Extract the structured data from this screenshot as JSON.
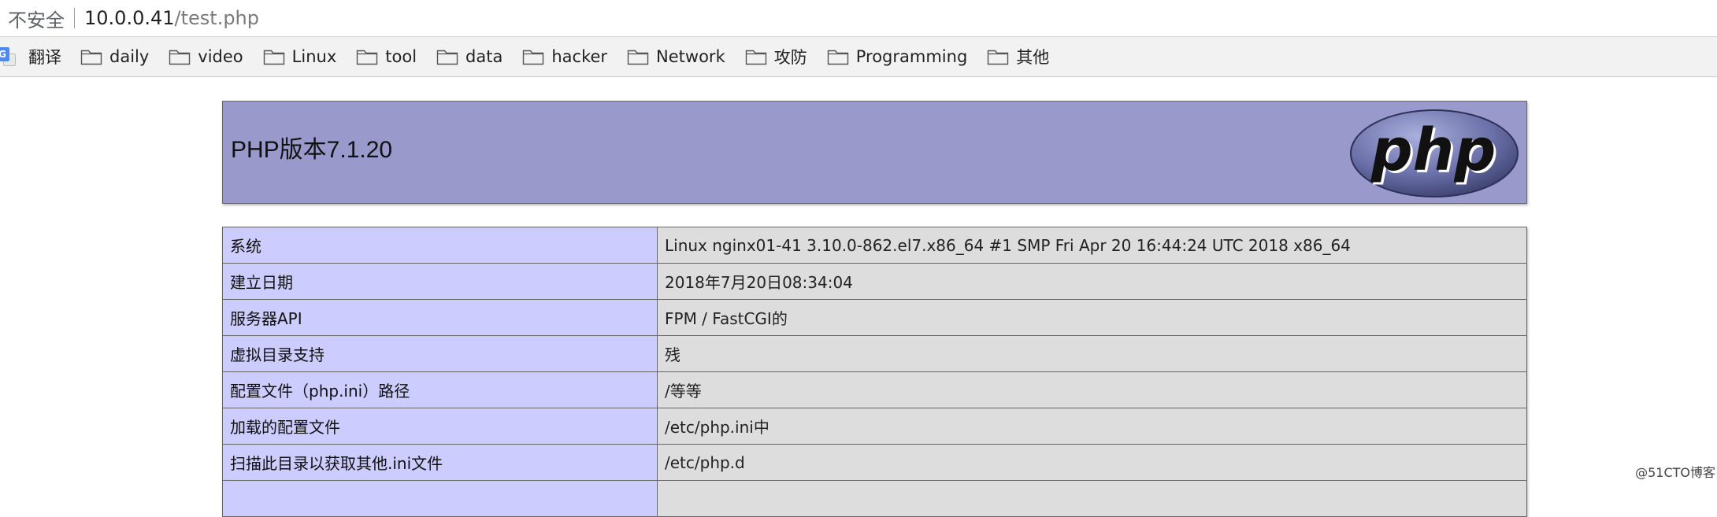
{
  "address_bar": {
    "security_label": "不安全",
    "host": "10.0.0.41",
    "path": "/test.php"
  },
  "bookmarks": [
    {
      "label": "翻译",
      "icon": "google-translate-icon"
    },
    {
      "label": "daily",
      "icon": "folder-icon"
    },
    {
      "label": "video",
      "icon": "folder-icon"
    },
    {
      "label": "Linux",
      "icon": "folder-icon"
    },
    {
      "label": "tool",
      "icon": "folder-icon"
    },
    {
      "label": "data",
      "icon": "folder-icon"
    },
    {
      "label": "hacker",
      "icon": "folder-icon"
    },
    {
      "label": "Network",
      "icon": "folder-icon"
    },
    {
      "label": "攻防",
      "icon": "folder-icon"
    },
    {
      "label": "Programming",
      "icon": "folder-icon"
    },
    {
      "label": "其他",
      "icon": "folder-icon"
    }
  ],
  "phpinfo": {
    "title": "PHP版本7.1.20",
    "logo_text": "php",
    "colors": {
      "header": "#9999cc",
      "key_cell": "#ccccff",
      "value_cell": "#dddddd"
    },
    "rows": [
      {
        "key": "系统",
        "value": "Linux nginx01-41 3.10.0-862.el7.x86_64 #1 SMP Fri Apr 20 16:44:24 UTC 2018 x86_64"
      },
      {
        "key": "建立日期",
        "value": "2018年7月20日08:34:04"
      },
      {
        "key": "服务器API",
        "value": "FPM / FastCGI的"
      },
      {
        "key": "虚拟目录支持",
        "value": "残"
      },
      {
        "key": "配置文件（php.ini）路径",
        "value": "/等等"
      },
      {
        "key": "加载的配置文件",
        "value": "/etc/php.ini中"
      },
      {
        "key": "扫描此目录以获取其他.ini文件",
        "value": "/etc/php.d"
      },
      {
        "key": "",
        "value": ""
      }
    ]
  },
  "watermark": "@51CTO博客"
}
